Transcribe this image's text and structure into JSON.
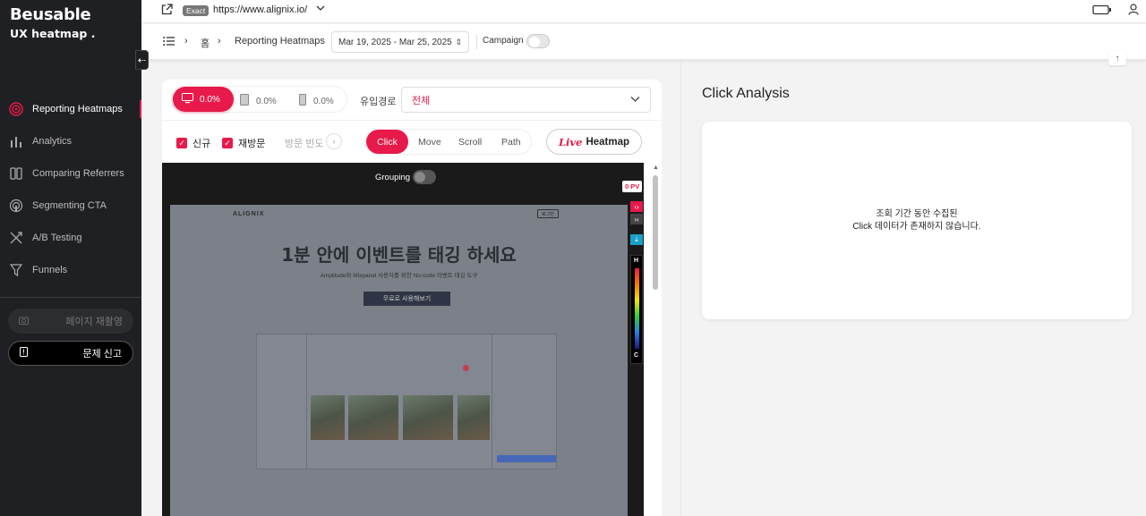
{
  "brand": {
    "logo": "Beusable",
    "subtitle": "UX heatmap ."
  },
  "sidebar": {
    "items": [
      {
        "label": "Reporting Heatmaps",
        "icon": "target-icon",
        "active": true
      },
      {
        "label": "Analytics",
        "icon": "bar-chart-icon",
        "active": false
      },
      {
        "label": "Comparing Referrers",
        "icon": "columns-icon",
        "active": false
      },
      {
        "label": "Segmenting CTA",
        "icon": "touch-icon",
        "active": false
      },
      {
        "label": "A/B Testing",
        "icon": "ab-icon",
        "active": false
      },
      {
        "label": "Funnels",
        "icon": "funnel-icon",
        "active": false
      }
    ],
    "record_label": "페이지 재촬영",
    "report_label": "문제 신고"
  },
  "topbar": {
    "exact_badge": "Exact",
    "url": "https://www.alignix.io/"
  },
  "filterbar": {
    "home": "홈",
    "page": "Reporting Heatmaps",
    "date_range": "Mar 19, 2025 - Mar 25, 2025",
    "campaign_label": "Campaign"
  },
  "devices": [
    {
      "name": "desktop",
      "value": "0.0%"
    },
    {
      "name": "tablet",
      "value": "0.0%"
    },
    {
      "name": "mobile",
      "value": "0.0%"
    }
  ],
  "inflow": {
    "label": "유입경로",
    "selected": "전체"
  },
  "filters": {
    "new_label": "신규",
    "returning_label": "재방문",
    "frequency_label": "방문 빈도"
  },
  "modes": {
    "click": "Click",
    "move": "Move",
    "scroll": "Scroll",
    "path": "Path",
    "live": "Live",
    "heatmap": "Heatmap"
  },
  "heatmap": {
    "grouping_label": "Grouping",
    "pv_badge": "0 PV",
    "legend_high": "H",
    "legend_low": "C"
  },
  "site": {
    "logo": "ALIGNIX",
    "login": "로그인",
    "title": "1분 안에 이벤트를 태깅 하세요",
    "subtitle": "Amplitude와 Mixpanel 사용자를 위한 No-code 이벤트 태깅 도구",
    "cta": "무료로 사용해보기"
  },
  "analysis": {
    "title": "Click Analysis",
    "empty_line1": "조회 기간 동안 수집된",
    "empty_line2": "Click 데이터가 존재하지 않습니다."
  },
  "colors": {
    "accent": "#e8194b",
    "sidebar_bg": "#1f2023"
  }
}
